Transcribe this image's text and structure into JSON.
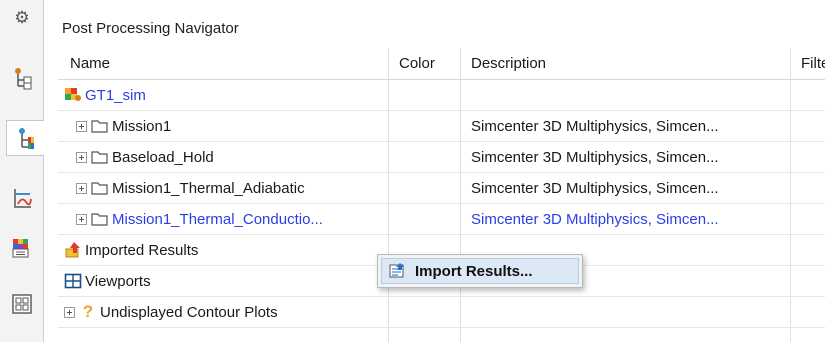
{
  "navigator": {
    "title": "Post Processing Navigator",
    "columns": {
      "name": "Name",
      "color": "Color",
      "description": "Description",
      "filter": "Filte"
    },
    "rows": [
      {
        "name": "GT1_sim",
        "description": ""
      },
      {
        "name": "Mission1",
        "description": "Simcenter 3D Multiphysics, Simcen..."
      },
      {
        "name": "Baseload_Hold",
        "description": "Simcenter 3D Multiphysics, Simcen..."
      },
      {
        "name": "Mission1_Thermal_Adiabatic",
        "description": "Simcenter 3D Multiphysics, Simcen..."
      },
      {
        "name": "Mission1_Thermal_Conductio...",
        "description": "Simcenter 3D Multiphysics, Simcen..."
      },
      {
        "name": "Imported Results",
        "description": ""
      },
      {
        "name": "Viewports",
        "description": ""
      },
      {
        "name": "Undisplayed Contour Plots",
        "description": ""
      }
    ]
  },
  "context_menu": {
    "items": [
      {
        "label": "Import Results..."
      }
    ]
  },
  "colors": {
    "selection_text": "#2b3de6",
    "menu_highlight": "#dce8f5"
  }
}
